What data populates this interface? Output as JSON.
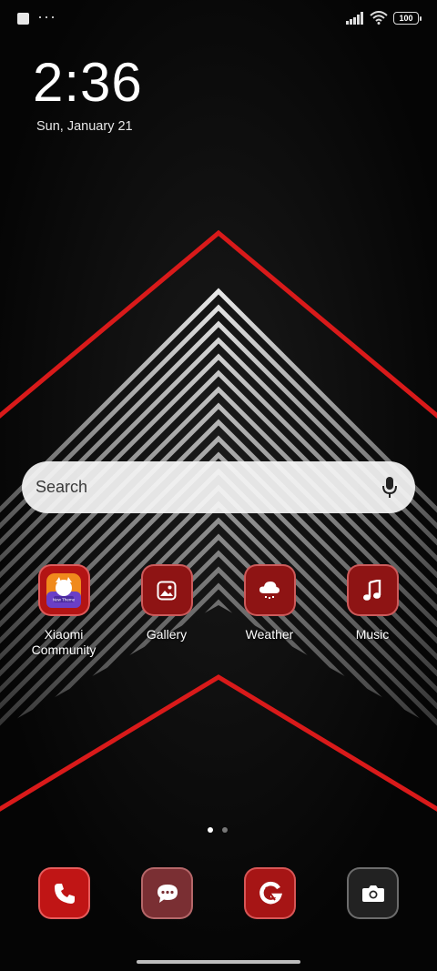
{
  "status_bar": {
    "battery": "100",
    "more_indicator": "···"
  },
  "lockscreen": {
    "time": "2:36",
    "date": "Sun, January 21"
  },
  "search": {
    "placeholder": "Search"
  },
  "apps": [
    {
      "label": "Xiaomi\nCommunity",
      "icon": "xiaomi-community-icon",
      "color": "#b31414"
    },
    {
      "label": "Gallery",
      "icon": "gallery-icon",
      "color": "#8e1414"
    },
    {
      "label": "Weather",
      "icon": "weather-icon",
      "color": "#8e1414"
    },
    {
      "label": "Music",
      "icon": "music-icon",
      "color": "#8e1414"
    }
  ],
  "dock": [
    {
      "icon": "phone-icon",
      "color": "#c01515"
    },
    {
      "icon": "messages-icon",
      "color": "#7a2f33"
    },
    {
      "icon": "browser-icon",
      "color": "#a61515"
    },
    {
      "icon": "camera-icon",
      "color": "#222222"
    }
  ],
  "page_indicator": {
    "pages": 2,
    "current": 1
  },
  "colors": {
    "accent": "#e01a1a",
    "wallpaper_bg": "#050505"
  }
}
